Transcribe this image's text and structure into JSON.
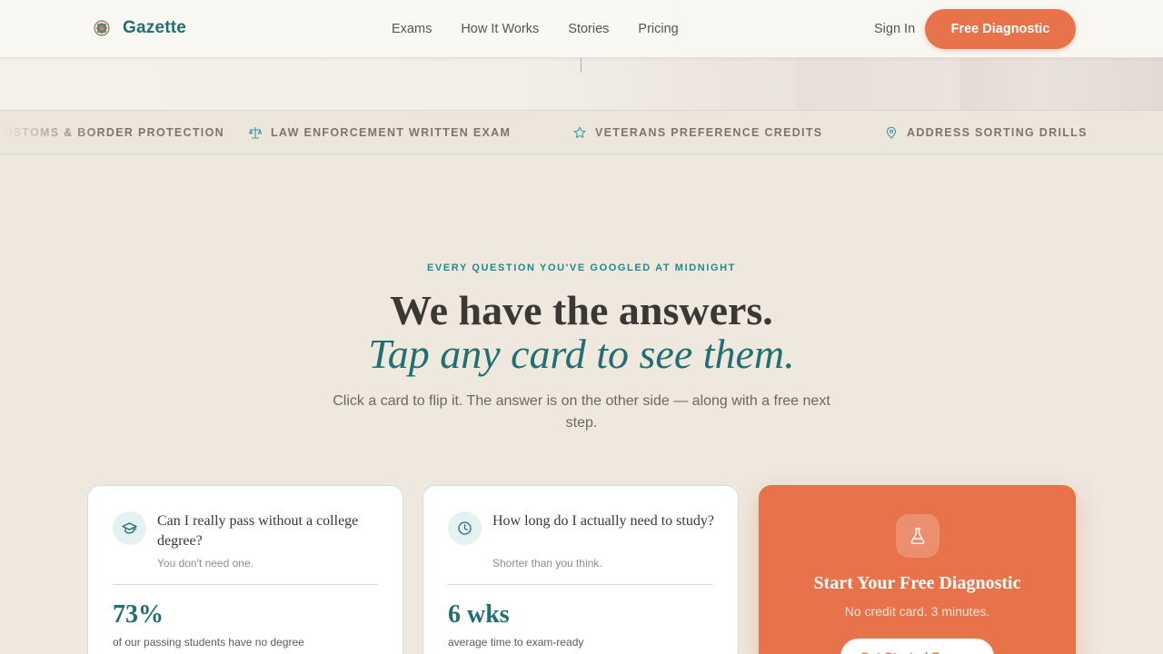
{
  "header": {
    "brand": "Gazette",
    "nav": [
      "Exams",
      "How It Works",
      "Stories",
      "Pricing"
    ],
    "sign_in": "Sign In",
    "cta": "Free Diagnostic"
  },
  "ticker": {
    "items": [
      {
        "label": "CUSTOMS & BORDER PROTECTION",
        "icon": "shield-icon"
      },
      {
        "label": "LAW ENFORCEMENT WRITTEN EXAM",
        "icon": "scales-icon"
      },
      {
        "label": "VETERANS PREFERENCE CREDITS",
        "icon": "star-icon"
      },
      {
        "label": "ADDRESS SORTING DRILLS",
        "icon": "map-pin-icon"
      }
    ]
  },
  "hero": {
    "eyebrow": "EVERY QUESTION YOU'VE GOOGLED AT MIDNIGHT",
    "headline": "We have the answers.",
    "headline_accent": "Tap any card to see them.",
    "subcopy": "Click a card to flip it. The answer is on the other side — along with a free next step."
  },
  "cards": [
    {
      "icon": "graduation-cap-icon",
      "question": "Can I really pass without a college degree?",
      "hint": "You don't need one.",
      "stat": "73%",
      "stat_label": "of our passing students have no degree"
    },
    {
      "icon": "clock-icon",
      "question": "How long do I actually need to study?",
      "hint": "Shorter than you think.",
      "stat": "6 wks",
      "stat_label": "average time to exam-ready"
    }
  ],
  "cta_card": {
    "icon": "flask-icon",
    "title": "Start Your Free Diagnostic",
    "subtitle": "No credit card. 3 minutes.",
    "button": "Get Started Free →"
  },
  "colors": {
    "accent": "#e8734a",
    "brand": "#1f6f73",
    "background": "#eee8de"
  }
}
